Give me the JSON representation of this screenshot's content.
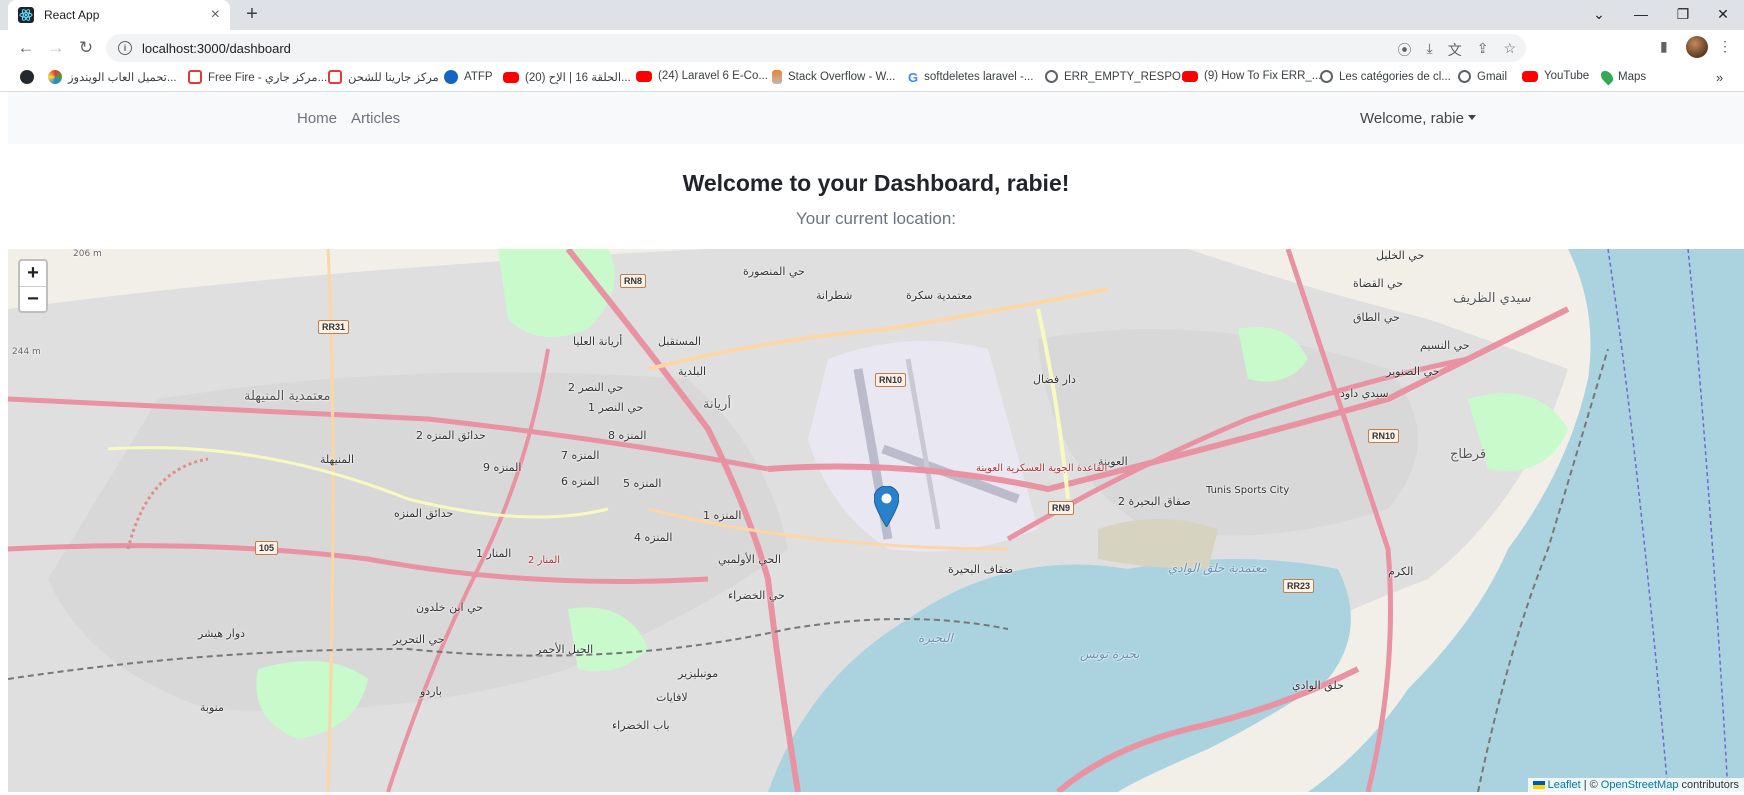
{
  "browser": {
    "tab_title": "React App",
    "url": "localhost:3000/dashboard",
    "bookmarks": [
      "تحميل العاب الويندوز...",
      "Free Fire - مركز جاري...",
      "مركز جارينا للشحن",
      "ATFP",
      "(20) الحلقة 16 | الإح...",
      "(24) Laravel 6 E-Co...",
      "Stack Overflow - W...",
      "softdeletes laravel -...",
      "ERR_EMPTY_RESPO...",
      "(9) How To Fix ERR_...",
      "Les catégories de cl...",
      "Gmail",
      "YouTube",
      "Maps"
    ]
  },
  "nav": {
    "home": "Home",
    "articles": "Articles",
    "user_menu": "Welcome, rabie"
  },
  "page": {
    "title": "Welcome to your Dashboard, rabie!",
    "subtitle": "Your current location:"
  },
  "map": {
    "zoom_in": "+",
    "zoom_out": "−",
    "attribution_leaflet": "Leaflet",
    "attribution_sep": "| ©",
    "attribution_osm": "OpenStreetMap",
    "attribution_tail": "contributors",
    "labels": [
      "حي المنصورة",
      "شطرانة",
      "معتمدية سكرة",
      "حي الخليل",
      "سيدي الظريف",
      "حي القضاة",
      "حي الطاق",
      "المستقبل",
      "أريانة العليا",
      "البلدية",
      "حي النصر 2",
      "حي النصر 1",
      "أريانة",
      "المنزه 8",
      "المنزه 7",
      "المنزه 9",
      "المنزه 6",
      "المنزه 5",
      "المنزه 1",
      "المنزه 4",
      "المنيهلة",
      "معتمدية المنيهلة",
      "حدائق المنزه 2",
      "حدائق المنزه",
      "المنار 1",
      "المنار 2",
      "الجبل الأحمر",
      "دوار هيشر",
      "منوبة",
      "باردو",
      "حي التحرير",
      "حي ابن خلدون",
      "حي الخضراء",
      "الحي الأولمبي",
      "مونبليزير",
      "لافايات",
      "باب الخضراء",
      "العوينة",
      "صفاق البحيرة 2",
      "ضفاف البحيرة",
      "دار فضال",
      "سيدي داود",
      "حي الصنوبر",
      "حي النسيم",
      "قرطاج",
      "الكرم",
      "حلق الوادي",
      "بحيرة تونس",
      "البحيرة",
      "معتمدية حلق الوادي",
      "Tunis Sports City",
      "القاعدة الجوية العسكرية العوينة",
      "RN8",
      "RN10",
      "RN9",
      "RR31",
      "RR23",
      "105",
      "206 m",
      "244 m"
    ]
  },
  "colors": {
    "water": "#aad3df",
    "land": "#f2efe9",
    "urban": "#e0dfdf",
    "park": "#c8facc",
    "trunk_road": "#e892a2",
    "primary_road": "#fcd6a4",
    "marker": "#2a81cb",
    "navbar_bg": "#f8f9fa"
  }
}
